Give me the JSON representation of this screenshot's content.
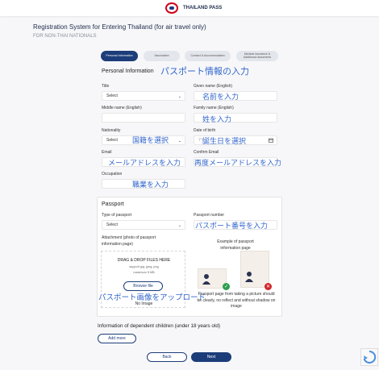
{
  "header": {
    "brand": "THAILAND PASS"
  },
  "page": {
    "title": "Registration System for Entering Thailand (for air travel only)",
    "subtitle": "FOR NON-THAI NATIONALS"
  },
  "steps": [
    {
      "label": "Personal Information",
      "active": true
    },
    {
      "label": "Vaccination",
      "active": false
    },
    {
      "label": "Contact & Accommodation",
      "active": false
    },
    {
      "label": "Medical insurance & Additional documents",
      "active": false
    }
  ],
  "personal": {
    "heading": "Personal Information",
    "heading_note": "パスポート情報の入力",
    "title_label": "Title",
    "title_value": "Select",
    "given_label": "Given name (English)",
    "given_note": "名前を入力",
    "middle_label": "Middle name (English)",
    "family_label": "Family name (English)",
    "family_note": "姓を入力",
    "nationality_label": "Nationality",
    "nationality_value": "Select",
    "nationality_note": "国籍を選択",
    "dob_label": "Date of birth",
    "dob_placeholder": "YY",
    "dob_note": "誕生日を選択",
    "email_label": "Email",
    "email_note": "メールアドレスを入力",
    "confirm_email_label": "Confirm Email",
    "confirm_email_note": "再度メールアドレスを入力",
    "occupation_label": "Occupation",
    "occupation_note": "職業を入力"
  },
  "passport": {
    "heading": "Passport",
    "type_label": "Type of passport",
    "type_value": "Select",
    "number_label": "Passport number",
    "number_note": "パスポート番号を入力",
    "attachment_label": "Attachment (photo of passport information page)",
    "drop_title": "DRAG & DROP FILES HERE",
    "drop_types": "support jpg, jpeg, png",
    "drop_max": "maximum 5 MB",
    "browse_label": "Browse file",
    "no_image": "No Image",
    "upload_note": "パスポート画像をアップロード",
    "example_title": "Example of passport information page",
    "example_caption": "Passport page from taking a picture should be clearly, no reflect and without shadow on image"
  },
  "dependents": {
    "heading": "Information of dependent children (under 18 years old)",
    "add_label": "Add more"
  },
  "footer": {
    "back_label": "Back",
    "next_label": "Next"
  },
  "colors": {
    "primary": "#1c3d7a",
    "note": "#3366cc",
    "ok": "#2e9e4f",
    "bad": "#d0262a"
  }
}
